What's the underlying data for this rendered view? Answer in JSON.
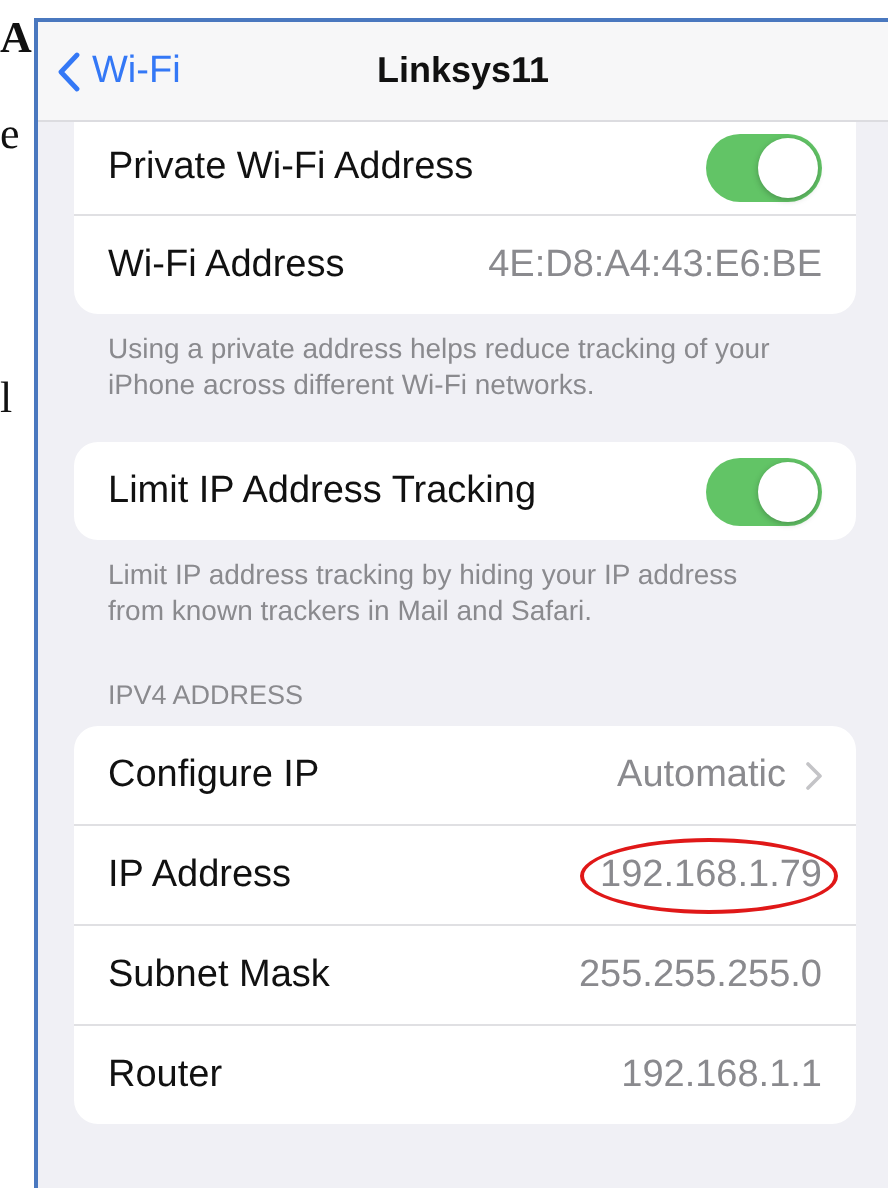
{
  "document_margin": [
    "A",
    "e",
    "l"
  ],
  "nav_bar": {
    "back_label": "Wi-Fi",
    "title": "Linksys11"
  },
  "sections": [
    {
      "rows": [
        {
          "kind": "toggle",
          "label": "Private Wi-Fi Address",
          "on": true
        },
        {
          "kind": "value",
          "label": "Wi-Fi Address",
          "value": "4E:D8:A4:43:E6:BE",
          "highlighted": false
        }
      ],
      "footer": "Using a private address helps reduce tracking of your iPhone across different Wi-Fi networks."
    },
    {
      "rows": [
        {
          "kind": "toggle",
          "label": "Limit IP Address Tracking",
          "on": true
        }
      ],
      "footer": "Limit IP address tracking by hiding your IP address from known trackers in Mail and Safari."
    },
    {
      "header": "IPV4 ADDRESS",
      "rows": [
        {
          "kind": "disclosure",
          "label": "Configure IP",
          "value": "Automatic"
        },
        {
          "kind": "value",
          "label": "IP Address",
          "value": "192.168.1.79",
          "highlighted": true
        },
        {
          "kind": "value",
          "label": "Subnet Mask",
          "value": "255.255.255.0",
          "highlighted": false
        },
        {
          "kind": "value",
          "label": "Router",
          "value": "192.168.1.1",
          "highlighted": false
        }
      ]
    }
  ]
}
